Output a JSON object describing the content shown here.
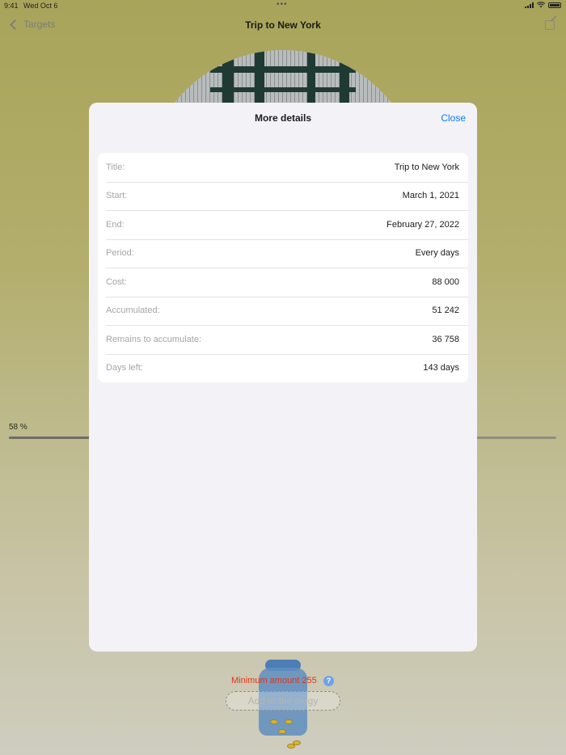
{
  "status_bar": {
    "time": "9:41",
    "date": "Wed Oct 6",
    "dots": "•••"
  },
  "nav": {
    "back_label": "Targets",
    "title": "Trip to New York"
  },
  "progress": {
    "label": "58 %",
    "value": 0.58
  },
  "modal": {
    "title": "More details",
    "close_label": "Close",
    "rows": [
      {
        "label": "Title:",
        "value": "Trip to New York"
      },
      {
        "label": "Start:",
        "value": "March 1, 2021"
      },
      {
        "label": "End:",
        "value": "February 27, 2022"
      },
      {
        "label": "Period:",
        "value": "Every days"
      },
      {
        "label": "Cost:",
        "value": "88 000"
      },
      {
        "label": "Accumulated:",
        "value": "51 242"
      },
      {
        "label": "Remains to accumulate:",
        "value": "36 758"
      },
      {
        "label": "Days left:",
        "value": "143 days"
      }
    ]
  },
  "bottom": {
    "min_amount": "Minimum amount 255",
    "help": "?",
    "add_placeholder": "Add to the piggy"
  },
  "colors": {
    "accent": "#0a7aff",
    "warning": "#e03417",
    "background_top": "#a8a45a",
    "background_bottom": "#cfcdbf"
  }
}
